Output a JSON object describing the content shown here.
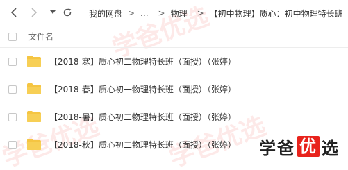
{
  "toolbar": {
    "back_icon": "chevron-left-icon",
    "forward_icon": "chevron-right-icon",
    "dropdown_icon": "caret-down-icon",
    "refresh_icon": "refresh-icon"
  },
  "breadcrumb": {
    "items": [
      "我的网盘",
      "...",
      "物理",
      "【初中物理】质心：初中物理特长班"
    ],
    "separator": ">"
  },
  "header": {
    "column_name": "文件名"
  },
  "files": [
    {
      "name": "【2018-寒】质心初二物理特长班（面授）（张婷）",
      "icon": "folder-icon"
    },
    {
      "name": "【2018-春】质心初一物理特长班（面授）（张婷）",
      "icon": "folder-icon"
    },
    {
      "name": "【2018-暑】质心初二物理特长班（面授）（张婷）",
      "icon": "folder-icon"
    },
    {
      "name": "【2018-秋】质心初二物理特长班（面授）（张婷）",
      "icon": "folder-icon"
    }
  ],
  "brand": {
    "part1": "学爸",
    "highlight": "优",
    "part2": "选",
    "watermark": "学爸优选"
  },
  "colors": {
    "folder": "#f5c542",
    "brand_red": "#e8231c",
    "text": "#333333",
    "muted": "#666666"
  }
}
